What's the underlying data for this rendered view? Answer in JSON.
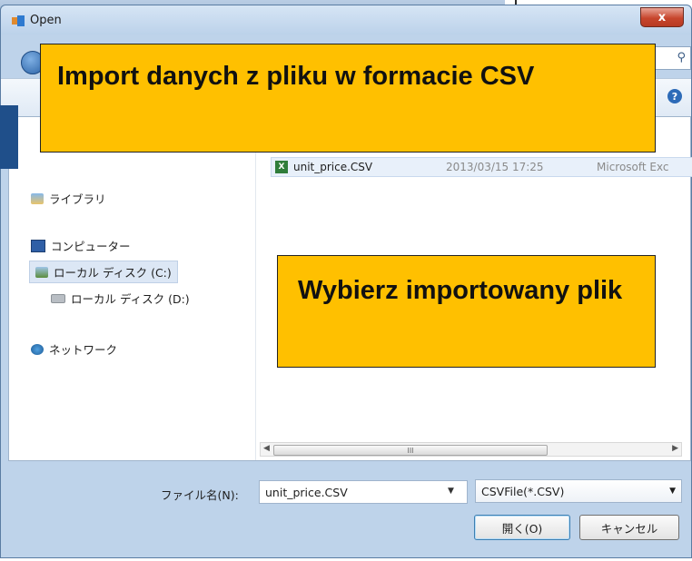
{
  "window": {
    "title": "Open",
    "close_label": "x"
  },
  "toolbar": {
    "help_label": "?"
  },
  "nav": {
    "items": [
      {
        "label": "ライブラリ",
        "icon": "library-icon"
      },
      {
        "label": "コンピューター",
        "icon": "computer-icon"
      },
      {
        "label": "ローカル ディスク (C:)",
        "icon": "disk-c-icon",
        "selected": true
      },
      {
        "label": "ローカル ディスク (D:)",
        "icon": "disk-d-icon"
      },
      {
        "label": "ネットワーク",
        "icon": "network-icon"
      }
    ]
  },
  "files": [
    {
      "name": "unit_price.CSV",
      "date": "2013/03/15 17:25",
      "type": "Microsoft Exc"
    }
  ],
  "scrollbar": {
    "thumb_grip": "III"
  },
  "form": {
    "filename_label": "ファイル名(N):",
    "filename_value": "unit_price.CSV",
    "filter_value": "CSVFile(*.CSV)",
    "open_button": "開く(O)",
    "cancel_button": "キャンセル"
  },
  "callouts": {
    "title": "Import danych z pliku w formacie CSV",
    "pick": "Wybierz importowany plik"
  },
  "colors": {
    "callout": "#ffc000",
    "title_bar": "#bcd2ea",
    "close_button": "#c7462d"
  }
}
